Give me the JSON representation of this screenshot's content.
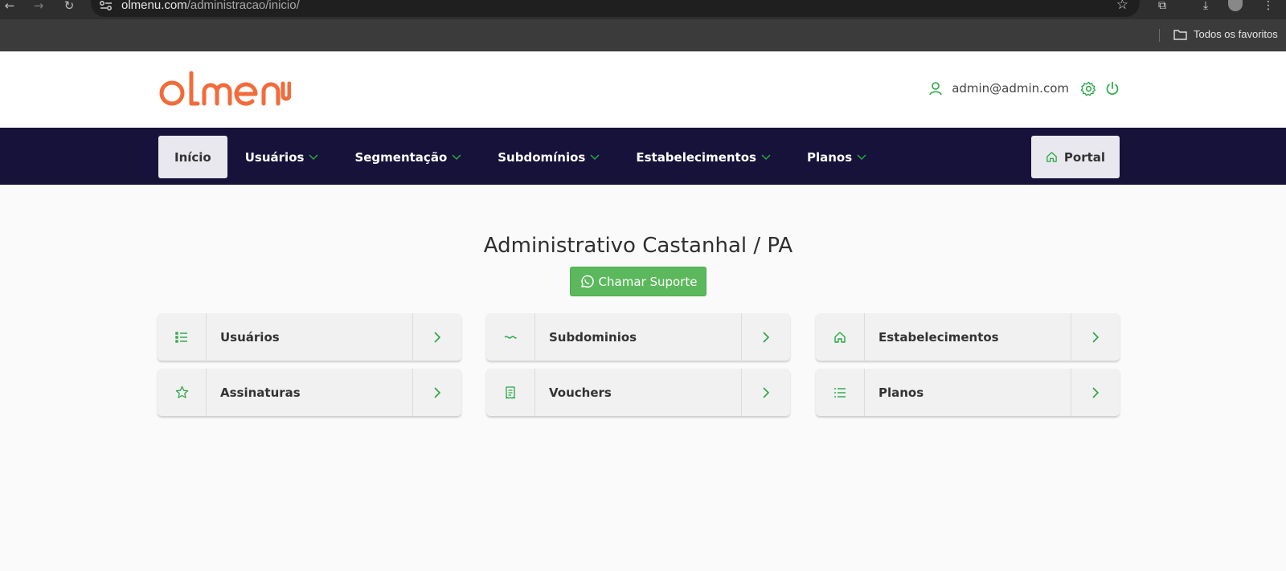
{
  "browser": {
    "url_host": "olmenu.com",
    "url_path": "/administracao/inicio/",
    "bookmarks_label": "Todos os favoritos"
  },
  "header": {
    "brand": "olmenu",
    "user_email": "admin@admin.com"
  },
  "nav": {
    "items": [
      {
        "label": "Início",
        "active": true,
        "dropdown": false
      },
      {
        "label": "Usuários",
        "dropdown": true
      },
      {
        "label": "Segmentação",
        "dropdown": true
      },
      {
        "label": "Subdomínios",
        "dropdown": true
      },
      {
        "label": "Estabelecimentos",
        "dropdown": true
      },
      {
        "label": "Planos",
        "dropdown": true
      }
    ],
    "portal_label": "Portal"
  },
  "main": {
    "title": "Administrativo Castanhal / PA",
    "support_label": "Chamar Suporte",
    "cards": [
      {
        "label": "Usuários",
        "icon": "list-bullet-icon"
      },
      {
        "label": "Subdominios",
        "icon": "wave-icon"
      },
      {
        "label": "Estabelecimentos",
        "icon": "home-icon"
      },
      {
        "label": "Assinaturas",
        "icon": "star-icon"
      },
      {
        "label": "Vouchers",
        "icon": "receipt-icon"
      },
      {
        "label": "Planos",
        "icon": "list-icon"
      }
    ]
  },
  "colors": {
    "brand_orange": "#f26b3a",
    "accent_green": "#28a745",
    "navbar_bg": "#16123a",
    "support_green": "#5cb85c"
  }
}
